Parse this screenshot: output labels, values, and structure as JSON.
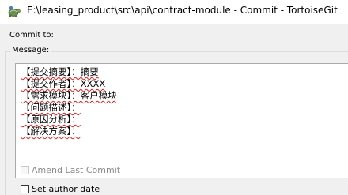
{
  "window": {
    "title": "E:\\leasing_product\\src\\api\\contract-module - Commit - TortoiseGit",
    "app_icon": "tortoisegit-icon"
  },
  "commit_to": {
    "label": "Commit to:"
  },
  "message_group": {
    "label": "Message:",
    "lines": [
      "【提交摘要】：摘要",
      "【提交作者】：XXXX",
      "【需求模块】：客户模块",
      "【问题描述】：",
      "【原因分析】：",
      "【解决方案】："
    ]
  },
  "options": {
    "amend_last_commit": {
      "label": "Amend Last Commit",
      "checked": false,
      "enabled": false
    },
    "set_author_date": {
      "label": "Set author date",
      "checked": false,
      "enabled": true
    }
  },
  "colors": {
    "spellcheck_underline": "#e02020",
    "dialog_background": "#f0f0f0"
  }
}
